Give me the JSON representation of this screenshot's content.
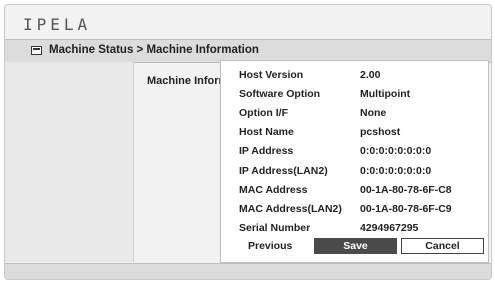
{
  "header": {
    "logo": "IPELA"
  },
  "breadcrumb": {
    "text": "Machine Status > Machine Information"
  },
  "main": {
    "label": "Machine Information"
  },
  "info": {
    "rows": [
      {
        "label": "Host Version",
        "value": "2.00"
      },
      {
        "label": "Software Option",
        "value": "Multipoint"
      },
      {
        "label": "Option I/F",
        "value": "None"
      },
      {
        "label": "Host Name",
        "value": "pcshost"
      },
      {
        "label": "IP Address",
        "value": "0:0:0:0:0:0:0:0"
      },
      {
        "label": "IP Address(LAN2)",
        "value": "0:0:0:0:0:0:0:0"
      },
      {
        "label": "MAC Address",
        "value": "00-1A-80-78-6F-C8"
      },
      {
        "label": "MAC Address(LAN2)",
        "value": "00-1A-80-78-6F-C9"
      },
      {
        "label": "Serial Number",
        "value": "4294967295"
      }
    ]
  },
  "buttons": {
    "previous": "Previous",
    "save": "Save",
    "cancel": "Cancel"
  }
}
